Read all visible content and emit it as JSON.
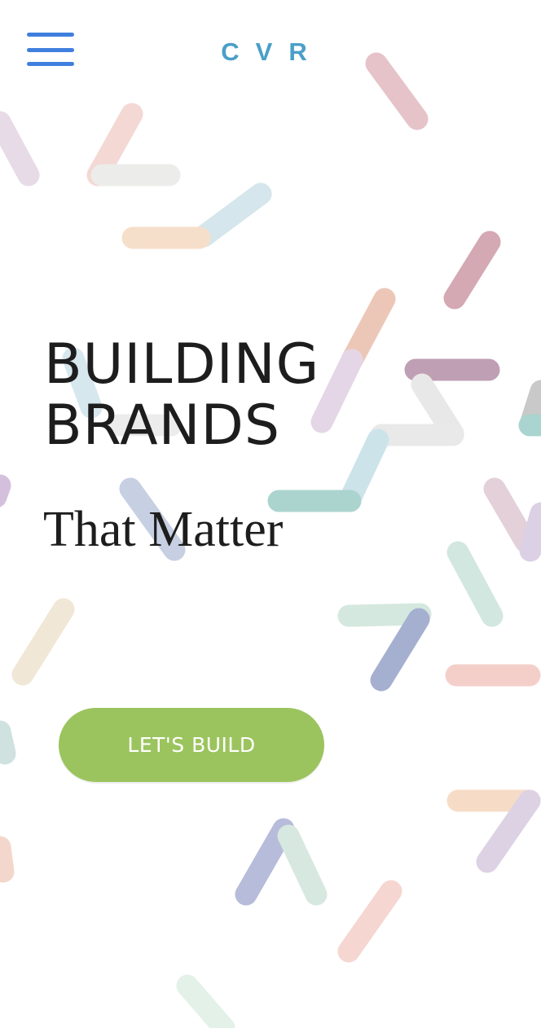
{
  "header": {
    "menu_icon": "hamburger-menu-icon",
    "logo_text": "CVR",
    "logo_color": "#4a9fc8",
    "menu_color": "#3f7fde"
  },
  "hero": {
    "headline_line1": "BUILDING",
    "headline_line2": "BRANDS",
    "subheadline": "That Matter",
    "cta_label": "LET'S BUILD",
    "cta_color": "#9bc45e"
  },
  "background": {
    "pattern": "decorative-confetti-strokes",
    "palette": [
      "#e8c3c3",
      "#cfe2ea",
      "#f4d9c0",
      "#b98b9d",
      "#d3d3d3",
      "#a9cfcc",
      "#b3bcd8",
      "#efe3cc",
      "#cfe5df",
      "#f3c7c0",
      "#dccde3"
    ]
  }
}
